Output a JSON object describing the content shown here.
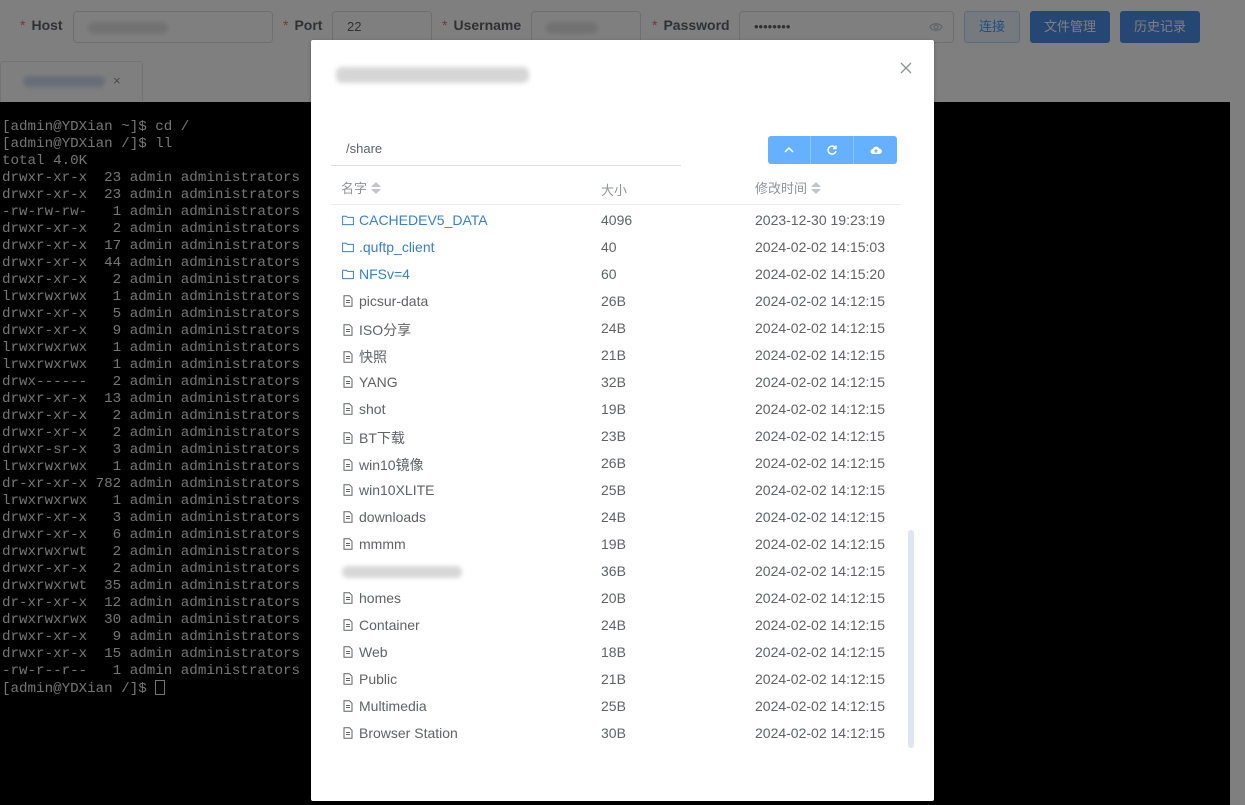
{
  "form": {
    "host_label": "Host",
    "port_label": "Port",
    "port_value": "22",
    "username_label": "Username",
    "password_label": "Password",
    "password_value": "••••••••",
    "required_mark": "*",
    "connect_label": "连接",
    "file_manage_label": "文件管理",
    "history_label": "历史记录",
    "colors": {
      "primary": "#4d8de8",
      "plain_bg": "#ecf5ff",
      "plain_text": "#409eff"
    }
  },
  "tab": {
    "close_label": "×"
  },
  "terminal": {
    "lines": [
      "[admin@YDXian ~]$ cd /",
      "[admin@YDXian /]$ ll",
      "total 4.0K",
      "drwxr-xr-x  23 admin administrators",
      "drwxr-xr-x  23 admin administrators",
      "-rw-rw-rw-   1 admin administrators",
      "drwxr-xr-x   2 admin administrators",
      "drwxr-xr-x  17 admin administrators",
      "drwxr-xr-x  44 admin administrators",
      "drwxr-xr-x   2 admin administrators",
      "lrwxrwxrwx   1 admin administrators",
      "drwxr-xr-x   5 admin administrators",
      "drwxr-xr-x   9 admin administrators",
      "lrwxrwxrwx   1 admin administrators",
      "lrwxrwxrwx   1 admin administrators",
      "drwx------   2 admin administrators",
      "drwxr-xr-x  13 admin administrators",
      "drwxr-xr-x   2 admin administrators",
      "drwxr-xr-x   2 admin administrators",
      "drwxr-sr-x   3 admin administrators",
      "lrwxrwxrwx   1 admin administrators",
      "dr-xr-xr-x 782 admin administrators",
      "lrwxrwxrwx   1 admin administrators",
      "drwxr-xr-x   3 admin administrators",
      "drwxr-xr-x   6 admin administrators",
      "drwxrwxrwt   2 admin administrators",
      "drwxr-xr-x   2 admin administrators",
      "drwxrwxrwt  35 admin administrators",
      "dr-xr-xr-x  12 admin administrators",
      "drwxrwxrwx  30 admin administrators",
      "drwxr-xr-x   9 admin administrators",
      "drwxr-xr-x  15 admin administrators",
      "-rw-r--r--   1 admin administrators"
    ],
    "prompt": "[admin@YDXian /]$ ",
    "colors": {
      "bg": "#000000",
      "fg": "#e8e8e8"
    }
  },
  "modal": {
    "path": "/share",
    "columns": {
      "name": "名字",
      "size": "大小",
      "modified": "修改时间"
    },
    "toolbar": {
      "up_icon": "chevron-up-icon",
      "refresh_icon": "refresh-icon",
      "upload_icon": "cloud-upload-icon"
    },
    "files": [
      {
        "name": "CACHEDEV5_DATA",
        "size": "4096",
        "time": "2023-12-30 19:23:19",
        "dir": true
      },
      {
        "name": ".quftp_client",
        "size": "40",
        "time": "2024-02-02 14:15:03",
        "dir": true
      },
      {
        "name": "NFSv=4",
        "size": "60",
        "time": "2024-02-02 14:15:20",
        "dir": true
      },
      {
        "name": "picsur-data",
        "size": "26B",
        "time": "2024-02-02 14:12:15",
        "dir": false
      },
      {
        "name": "ISO分享",
        "size": "24B",
        "time": "2024-02-02 14:12:15",
        "dir": false
      },
      {
        "name": "快照",
        "size": "21B",
        "time": "2024-02-02 14:12:15",
        "dir": false
      },
      {
        "name": "YANG",
        "size": "32B",
        "time": "2024-02-02 14:12:15",
        "dir": false
      },
      {
        "name": "shot",
        "size": "19B",
        "time": "2024-02-02 14:12:15",
        "dir": false
      },
      {
        "name": "BT下载",
        "size": "23B",
        "time": "2024-02-02 14:12:15",
        "dir": false
      },
      {
        "name": "win10镜像",
        "size": "26B",
        "time": "2024-02-02 14:12:15",
        "dir": false
      },
      {
        "name": "win10XLITE",
        "size": "25B",
        "time": "2024-02-02 14:12:15",
        "dir": false
      },
      {
        "name": "downloads",
        "size": "24B",
        "time": "2024-02-02 14:12:15",
        "dir": false
      },
      {
        "name": "mmmm",
        "size": "19B",
        "time": "2024-02-02 14:12:15",
        "dir": false
      },
      {
        "name": "",
        "size": "36B",
        "time": "2024-02-02 14:12:15",
        "dir": false,
        "blurred": true
      },
      {
        "name": "homes",
        "size": "20B",
        "time": "2024-02-02 14:12:15",
        "dir": false
      },
      {
        "name": "Container",
        "size": "24B",
        "time": "2024-02-02 14:12:15",
        "dir": false
      },
      {
        "name": "Web",
        "size": "18B",
        "time": "2024-02-02 14:12:15",
        "dir": false
      },
      {
        "name": "Public",
        "size": "21B",
        "time": "2024-02-02 14:12:15",
        "dir": false
      },
      {
        "name": "Multimedia",
        "size": "25B",
        "time": "2024-02-02 14:12:15",
        "dir": false
      },
      {
        "name": "Browser Station",
        "size": "30B",
        "time": "2024-02-02 14:12:15",
        "dir": false
      }
    ],
    "colors": {
      "dir_text": "#3a7fc8",
      "file_text": "#606266",
      "toolbar_btn": "#66b1ff"
    }
  }
}
